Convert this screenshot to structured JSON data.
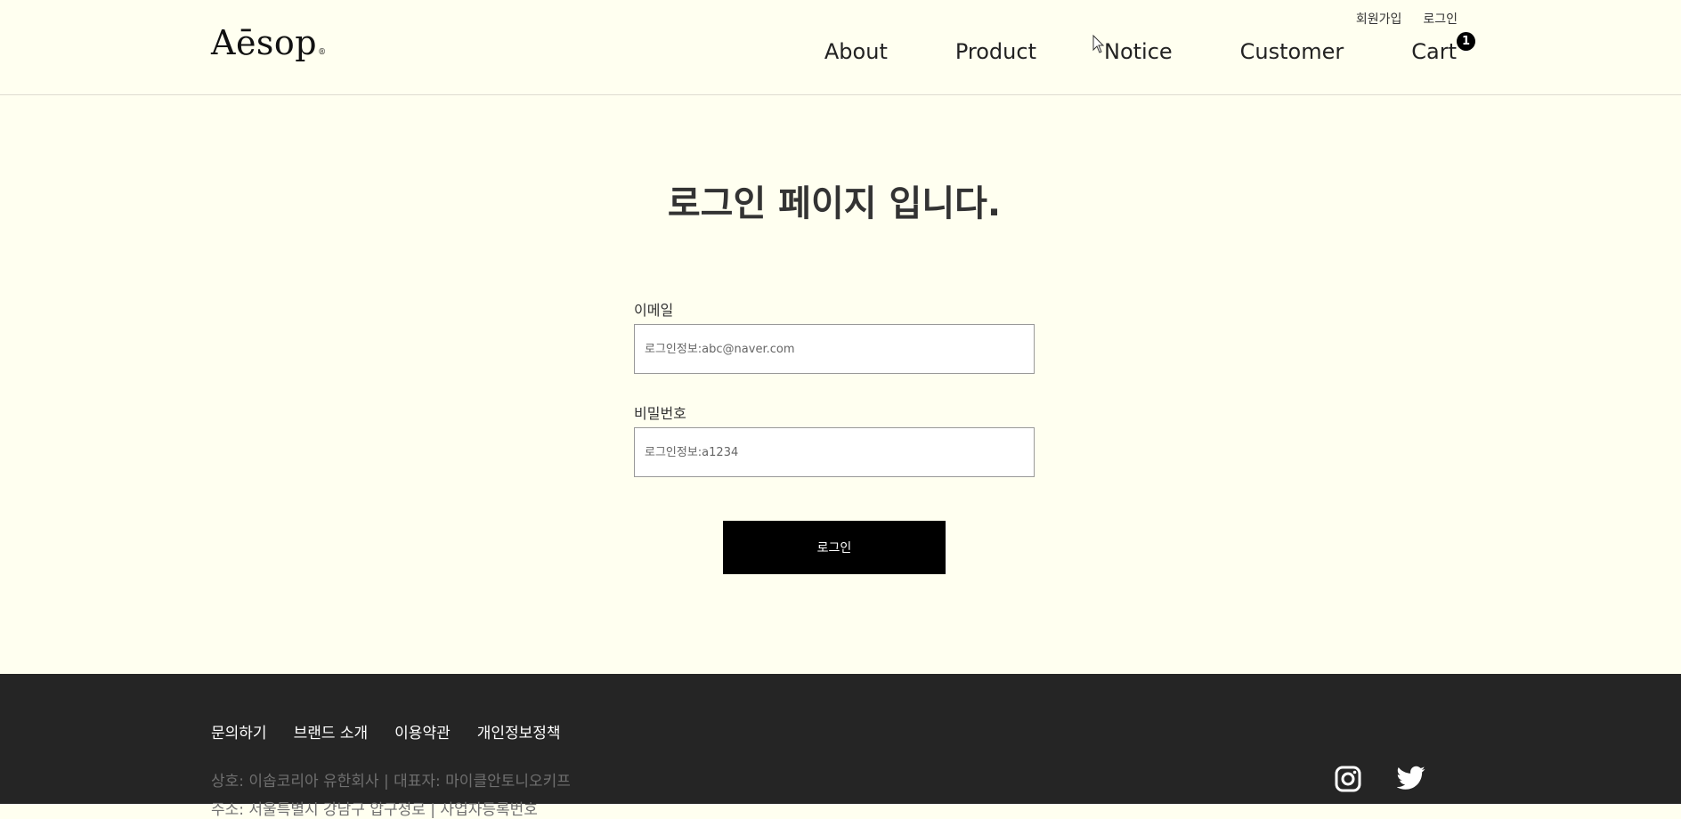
{
  "header": {
    "logo": "Aēsop",
    "logo_mark": "®",
    "util_links": {
      "signup": "회원가입",
      "login": "로그인"
    },
    "nav": {
      "about": "About",
      "product": "Product",
      "notice": "Notice",
      "customer": "Customer",
      "cart": "Cart"
    },
    "cart_count": "1"
  },
  "main": {
    "title": "로그인 페이지 입니다.",
    "email_label": "이메일",
    "email_placeholder": "로그인정보:abc@naver.com",
    "password_label": "비밀번호",
    "password_placeholder": "로그인정보:a1234",
    "login_button": "로그인"
  },
  "footer": {
    "links": {
      "inquiry": "문의하기",
      "brand": "브랜드 소개",
      "terms": "이용약관",
      "privacy": "개인정보정책"
    },
    "company_info": "상호: 이솝코리아 유한회사 | 대표자: 마이클안토니오키프",
    "company_info_2": "주소: 서울특별시 강남구 압구정로 | 사업자등록번호"
  },
  "icons": {
    "instagram": "instagram-icon",
    "twitter": "twitter-icon",
    "cursor": "mouse-pointer-icon"
  },
  "colors": {
    "background": "#fffff0",
    "footer": "#252525",
    "button": "#000000"
  }
}
